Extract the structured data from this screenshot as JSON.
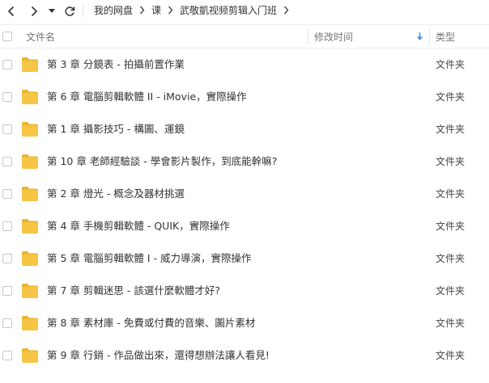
{
  "breadcrumb": {
    "items": [
      "我的网盘",
      "课",
      "武敬凱视频剪辑入门班"
    ]
  },
  "table": {
    "columns": {
      "name": "文件名",
      "modified": "修改时间",
      "type": "类型"
    },
    "rows": [
      {
        "name": "第 3 章 分鏡表 - 拍攝前置作業",
        "type": "文件夹"
      },
      {
        "name": "第 6 章 電腦剪輯軟體 II - iMovie，實際操作",
        "type": "文件夹"
      },
      {
        "name": "第 1 章 攝影技巧 - 構圖、運鏡",
        "type": "文件夹"
      },
      {
        "name": "第 10 章 老師經驗談 - 學會影片製作，到底能幹嘛?",
        "type": "文件夹"
      },
      {
        "name": "第 2 章 燈光 - 概念及器材挑選",
        "type": "文件夹"
      },
      {
        "name": "第 4 章 手機剪輯軟體 - QUIK，實際操作",
        "type": "文件夹"
      },
      {
        "name": "第 5 章 電腦剪輯軟體 I - 威力導演，實際操作",
        "type": "文件夹"
      },
      {
        "name": "第 7 章 剪輯迷思 - 該選什麼軟體才好?",
        "type": "文件夹"
      },
      {
        "name": "第 8 章 素材庫 - 免費或付費的音樂、圖片素材",
        "type": "文件夹"
      },
      {
        "name": "第 9 章 行銷 - 作品做出來，還得想辦法讓人看見!",
        "type": "文件夹"
      }
    ]
  },
  "colors": {
    "folder": "#f7c545",
    "folder_tab": "#eab52f",
    "sort_arrow": "#3b8ff5"
  }
}
